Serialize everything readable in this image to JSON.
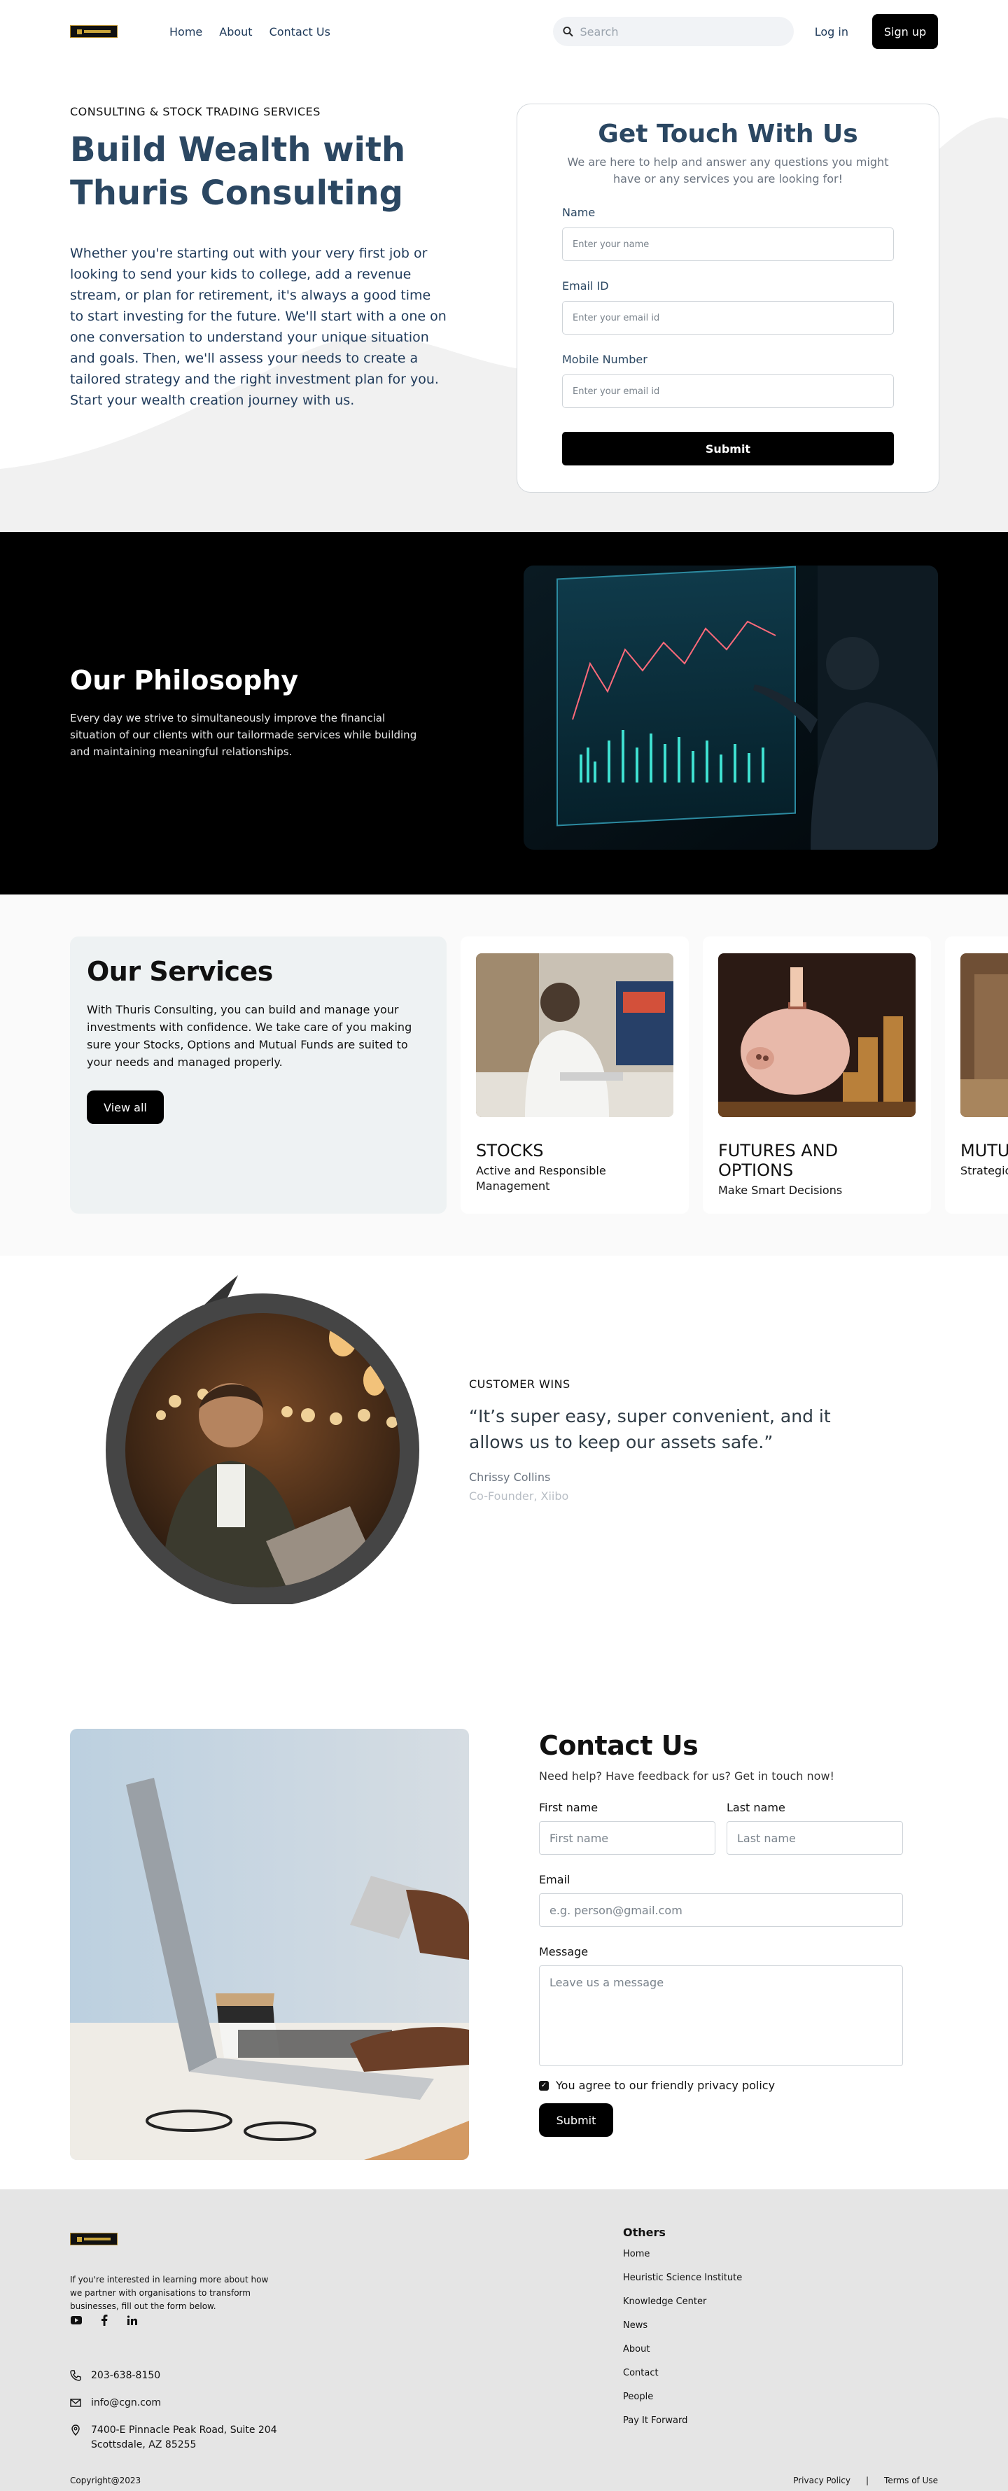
{
  "nav": {
    "links": [
      "Home",
      "About",
      "Contact Us"
    ],
    "search_placeholder": "Search",
    "login": "Log in",
    "signup": "Sign up"
  },
  "hero": {
    "eyebrow": "CONSULTING & STOCK TRADING SERVICES",
    "title_line1": "Build Wealth with",
    "title_line2": "Thuris Consulting",
    "body": "Whether you're starting out with your very first job or looking to send your kids to college, add a revenue stream, or plan for retirement, it's always a good time to start investing for the future. We'll start with a one on one conversation to understand your unique situation and goals. Then, we'll assess your needs to create a tailored strategy and the right investment plan for you. Start your wealth creation journey with us."
  },
  "touch_form": {
    "title": "Get Touch With Us",
    "subtitle": "We are here to help and answer any questions you might have or any services you are looking for!",
    "name_label": "Name",
    "name_placeholder": "Enter your name",
    "email_label": "Email ID",
    "email_placeholder": "Enter your email id",
    "mobile_label": "Mobile Number",
    "mobile_placeholder": "Enter your email id",
    "submit": "Submit"
  },
  "philosophy": {
    "title": "Our Philosophy",
    "body": "Every day we strive to simultaneously improve the financial situation of our clients with our tailormade services while building and maintaining meaningful relationships."
  },
  "services": {
    "title": "Our Services",
    "body": "With Thuris Consulting, you can build and manage your investments with confidence. We take care of you making sure your Stocks, Options and Mutual Funds are suited to your needs and managed properly.",
    "view_all": "View all",
    "cards": [
      {
        "title": "STOCKS",
        "desc": "Active and Responsible Management"
      },
      {
        "title": "FUTURES AND OPTIONS",
        "desc": "Make Smart Decisions"
      },
      {
        "title": "MUTUAL",
        "desc": "Strategic"
      }
    ]
  },
  "testimonial": {
    "tag": "CUSTOMER WINS",
    "quote": "“It’s super easy, super convenient, and it allows us to keep our assets safe.”",
    "name": "Chrissy Collins",
    "role": "Co-Founder, Xiibo"
  },
  "contact": {
    "title": "Contact Us",
    "subtitle": "Need help? Have feedback for us? Get in touch now!",
    "first_label": "First name",
    "first_placeholder": "First name",
    "last_label": "Last name",
    "last_placeholder": "Last name",
    "email_label": "Email",
    "email_placeholder": "e.g. person@gmail.com",
    "message_label": "Message",
    "message_placeholder": "Leave us a message",
    "agree": "You agree to our friendly privacy policy",
    "submit": "Submit"
  },
  "footer": {
    "about": "If you're interested in learning more about how we partner with organisations to transform businesses, fill out the form below.",
    "phone": "203-638-8150",
    "email": "info@cgn.com",
    "address_line1": "7400-E Pinnacle Peak Road, Suite 204",
    "address_line2": "Scottsdale, AZ 85255",
    "links_title": "Others",
    "links": [
      "Home",
      "Heuristic Science Institute",
      "Knowledge Center",
      "News",
      "About",
      "Contact",
      "People",
      "Pay It Forward"
    ],
    "copyright": "Copyright@2023",
    "privacy": "Privacy Policy",
    "separator": "|",
    "terms": "Terms of Use"
  },
  "colors": {
    "heading": "#2b4762",
    "body": "#1f3a5a",
    "button": "#000000",
    "footer_bg": "#e5e5e5"
  }
}
